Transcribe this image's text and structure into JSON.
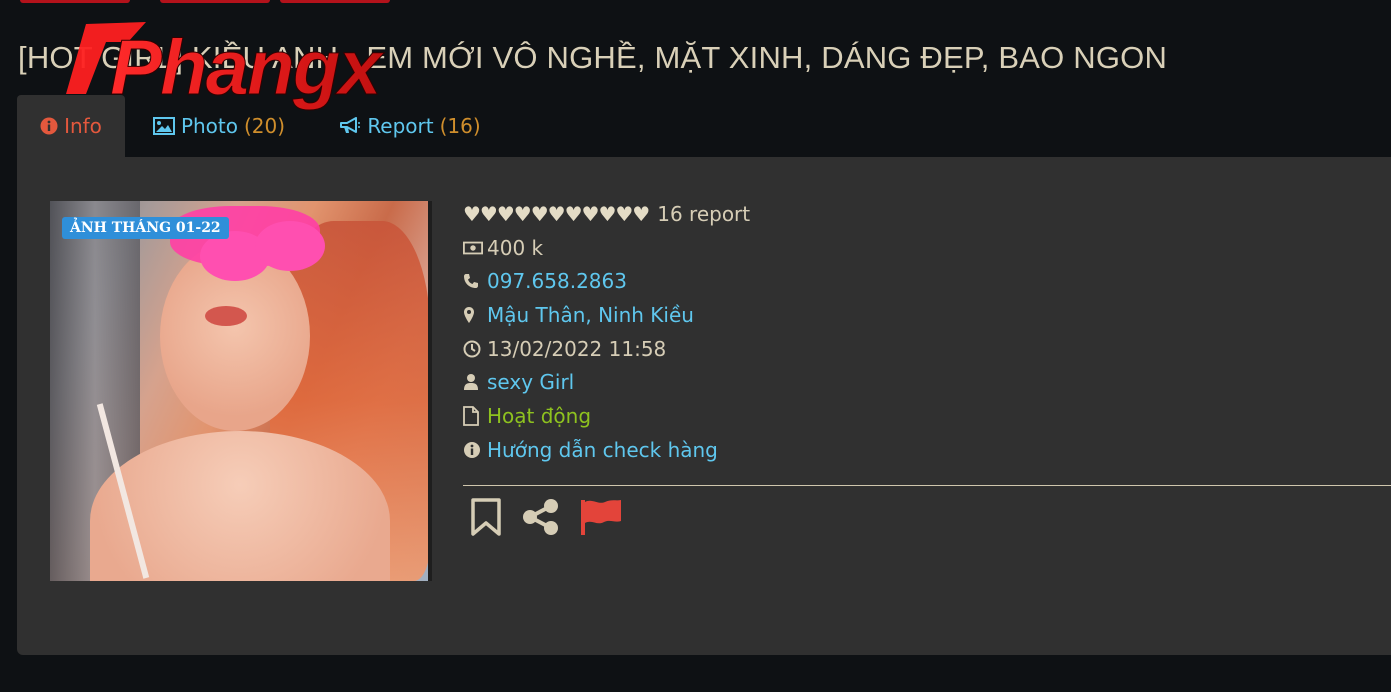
{
  "header": {
    "title": "[HOT GIRL] KIỀU ANH - EM MỚI VÔ NGHỀ, MẶT XINH, DÁNG ĐẸP, BAO NGON",
    "logo_text": "Phangx"
  },
  "tabs": [
    {
      "label": "Info",
      "count": "",
      "icon": "info-circle-icon",
      "active": true
    },
    {
      "label": "Photo",
      "count": "(20)",
      "icon": "image-icon",
      "active": false
    },
    {
      "label": "Report",
      "count": "(16)",
      "icon": "bullhorn-icon",
      "active": false
    }
  ],
  "profile": {
    "photo_badge": "ẢNH THÁNG 01-22",
    "rating_hearts": "♥♥♥♥♥♥♥♥♥♥♥",
    "report_count": "16 report",
    "price": "400 k",
    "phone": "097.658.2863",
    "location": "Mậu Thân, Ninh Kiều",
    "date": "13/02/2022 11:58",
    "category": "sexy Girl",
    "status": "Hoạt động",
    "guide": "Hướng dẫn check hàng"
  },
  "colors": {
    "accent_red": "#e3583d",
    "link_blue": "#5fc7ee",
    "count_orange": "#cf8e2c",
    "status_green": "#8ec21f",
    "panel_bg": "#303030",
    "page_bg": "#0e1114"
  }
}
